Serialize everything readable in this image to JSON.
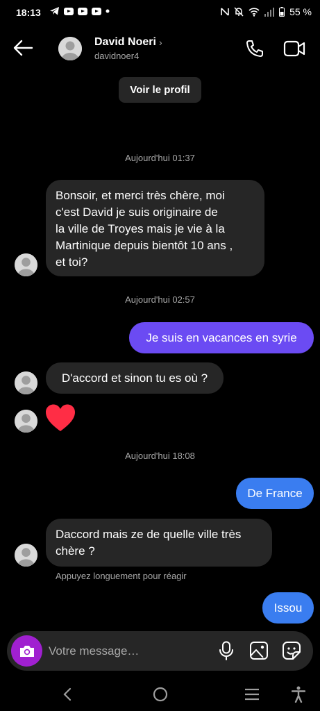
{
  "status_bar": {
    "time": "18:13",
    "battery": "55 %"
  },
  "header": {
    "name": "David Noeri",
    "username": "davidnoer4",
    "profile_button": "Voir le profil"
  },
  "messages": [
    {
      "type": "timestamp",
      "text": "Aujourd'hui 01:37"
    },
    {
      "type": "incoming",
      "lines": [
        "Bonsoir, et merci très chère, moi",
        "c'est David je suis originaire de",
        "la ville de Troyes mais je vie à la",
        "Martinique depuis bientôt 10 ans ,",
        "et toi?"
      ]
    },
    {
      "type": "timestamp",
      "text": "Aujourd'hui 02:57"
    },
    {
      "type": "outgoing",
      "text": "Je suis en vacances en syrie"
    },
    {
      "type": "incoming",
      "text": "D'accord et sinon tu es où ?"
    },
    {
      "type": "incoming-reaction",
      "emoji": "heart"
    },
    {
      "type": "timestamp",
      "text": "Aujourd'hui 18:08"
    },
    {
      "type": "outgoing",
      "text": "De France"
    },
    {
      "type": "incoming",
      "lines": [
        "Daccord mais ze de quelle ville très",
        "chère ?"
      ]
    },
    {
      "type": "hint",
      "text": "Appuyez longuement pour réagir"
    },
    {
      "type": "outgoing",
      "text": "Issou"
    }
  ],
  "composer": {
    "placeholder": "Votre message…"
  },
  "colors": {
    "background": "#000000",
    "incoming_bubble": "#262626",
    "outgoing_purple": "#6b4bf3",
    "outgoing_blue": "#3a7df0",
    "camera_button": "#a020d0",
    "heart": "#ff2d45"
  }
}
